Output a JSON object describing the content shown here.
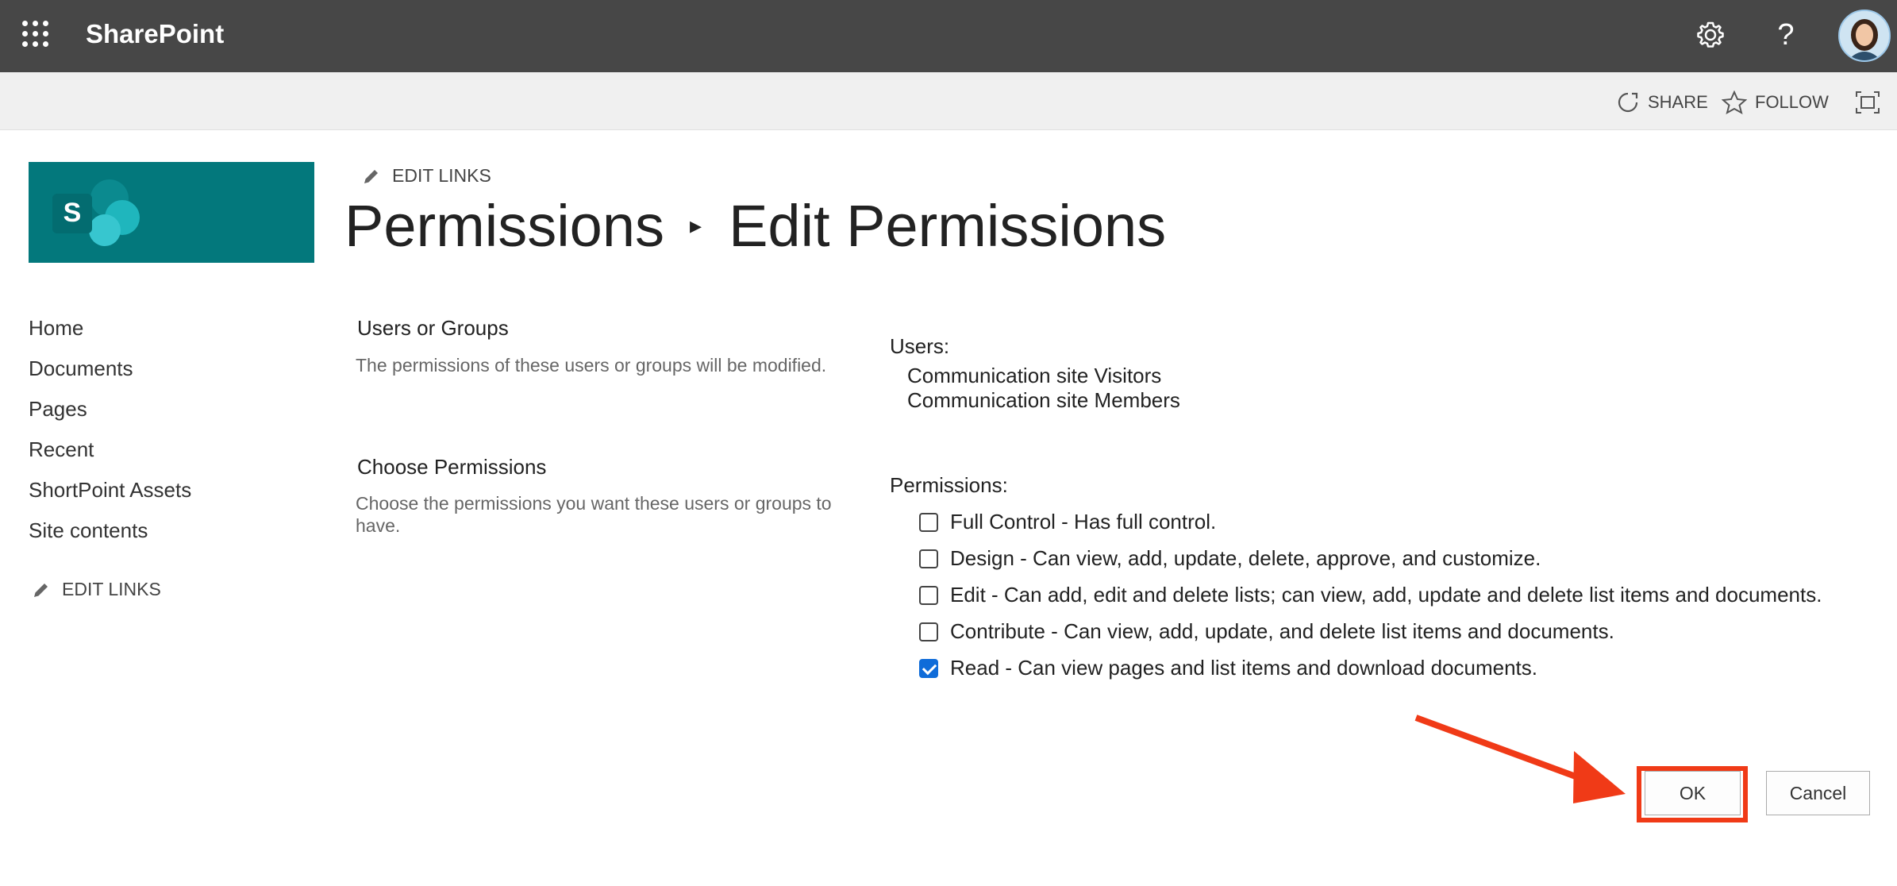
{
  "app": {
    "name": "SharePoint"
  },
  "suitebar": {
    "waffle_icon": "app-launcher-icon",
    "settings_icon": "gear-icon",
    "help_icon": "help-icon",
    "help_glyph": "?"
  },
  "actions": {
    "share": "SHARE",
    "follow": "FOLLOW"
  },
  "header": {
    "edit_links": "EDIT LINKS",
    "breadcrumb_parent": "Permissions",
    "breadcrumb_current": "Edit Permissions",
    "separator": "▸"
  },
  "logo": {
    "letter": "S"
  },
  "nav": {
    "items": [
      "Home",
      "Documents",
      "Pages",
      "Recent",
      "ShortPoint Assets",
      "Site contents"
    ],
    "edit_links": "EDIT LINKS"
  },
  "form": {
    "users_section": {
      "title": "Users or Groups",
      "description": "The permissions of these users or groups will be modified."
    },
    "permissions_section": {
      "title": "Choose Permissions",
      "description": "Choose the permissions you want these users or groups to have."
    },
    "users_label": "Users:",
    "users": [
      "Communication site Visitors",
      "Communication site Members"
    ],
    "permissions_label": "Permissions:",
    "permissions": [
      {
        "label": "Full Control - Has full control.",
        "checked": false
      },
      {
        "label": "Design - Can view, add, update, delete, approve, and customize.",
        "checked": false
      },
      {
        "label": "Edit - Can add, edit and delete lists; can view, add, update and delete list items and documents.",
        "checked": false
      },
      {
        "label": "Contribute - Can view, add, update, and delete list items and documents.",
        "checked": false
      },
      {
        "label": "Read - Can view pages and list items and download documents.",
        "checked": true
      }
    ]
  },
  "buttons": {
    "ok": "OK",
    "cancel": "Cancel"
  },
  "colors": {
    "suitebar": "#474747",
    "logo": "#03787c",
    "highlight": "#f03a17",
    "checkbox": "#0f6cd9"
  }
}
